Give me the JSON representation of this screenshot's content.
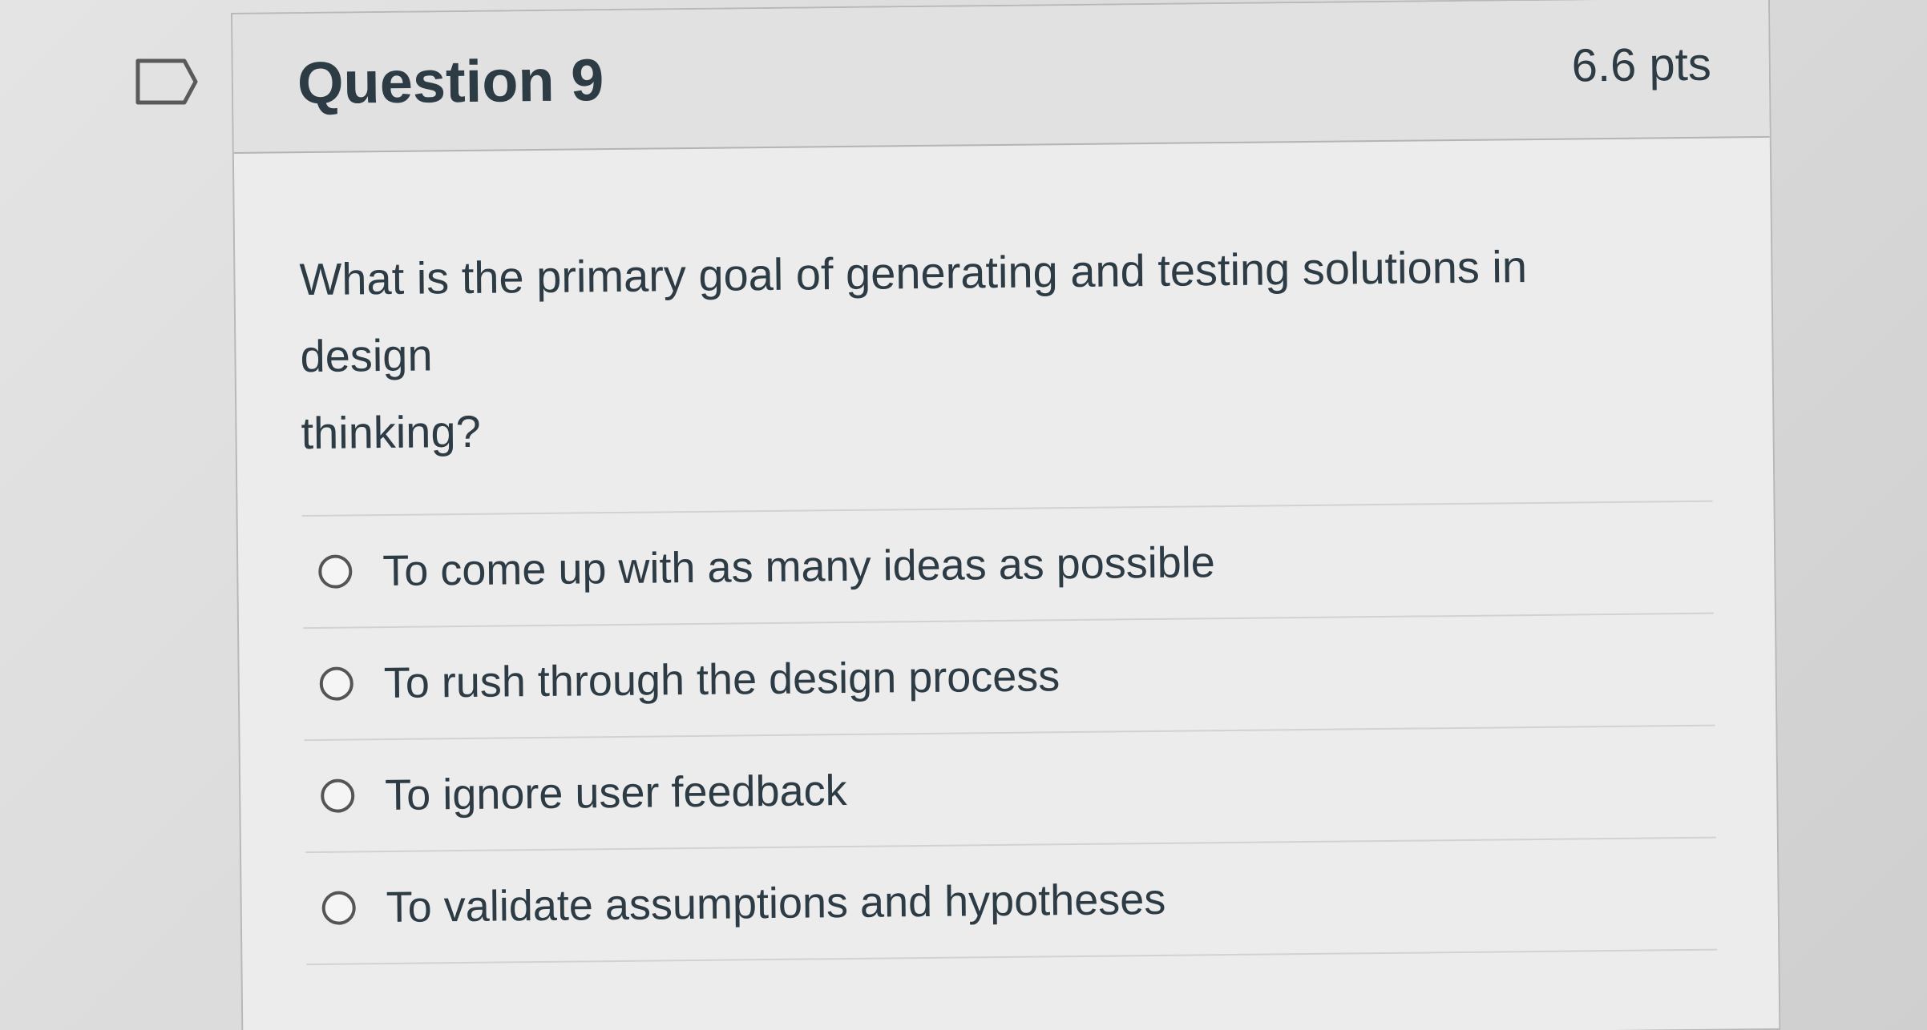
{
  "question": {
    "title": "Question 9",
    "points": "6.6 pts",
    "text_lines": [
      "What is the primary goal of generating and testing solutions in",
      "design",
      "thinking?"
    ],
    "flag_icon": "flag-outline-icon"
  },
  "answers": [
    {
      "label": "To come up with as many ideas as possible",
      "selected": false
    },
    {
      "label": "To rush through the design process",
      "selected": false
    },
    {
      "label": "To ignore user feedback",
      "selected": false
    },
    {
      "label": "To validate assumptions and hypotheses",
      "selected": false
    }
  ]
}
